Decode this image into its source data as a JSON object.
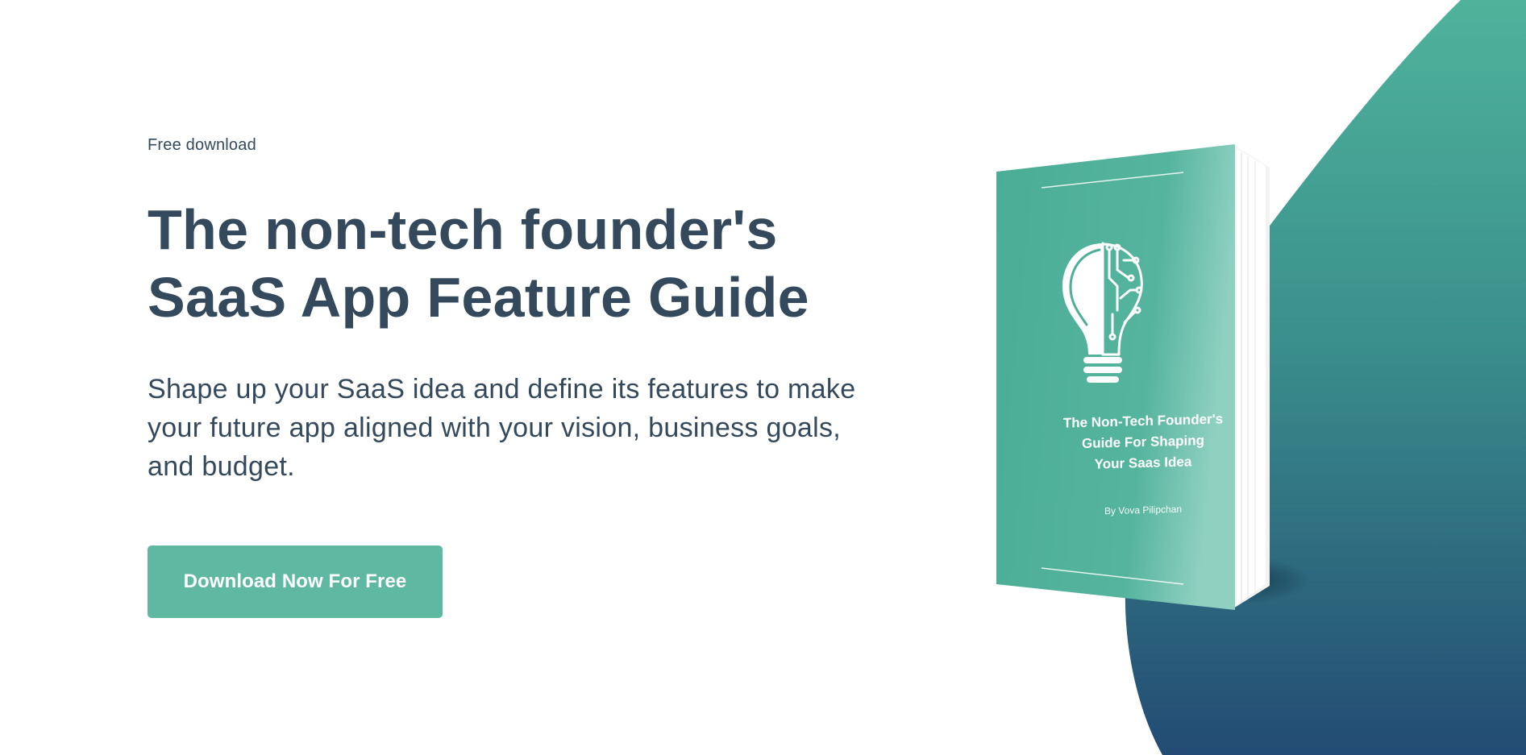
{
  "colors": {
    "text": "#344a5c",
    "accent": "#5eb8a2",
    "blob_top": "#4fb39b",
    "blob_bottom": "#234b73",
    "book_cover": "#4fae98"
  },
  "hero": {
    "eyebrow": "Free download",
    "title": "The non-tech founder's SaaS App Feature Guide",
    "subtitle": "Shape up your SaaS idea and define its features to make your future app aligned with your vision, business goals, and budget.",
    "cta_label": "Download Now For Free"
  },
  "book": {
    "title": "The Non-Tech Founder's\nGuide For Shaping\nYour Saas Idea",
    "author": "By Vova Pilipchan",
    "icon": "lightbulb-circuit-icon"
  }
}
